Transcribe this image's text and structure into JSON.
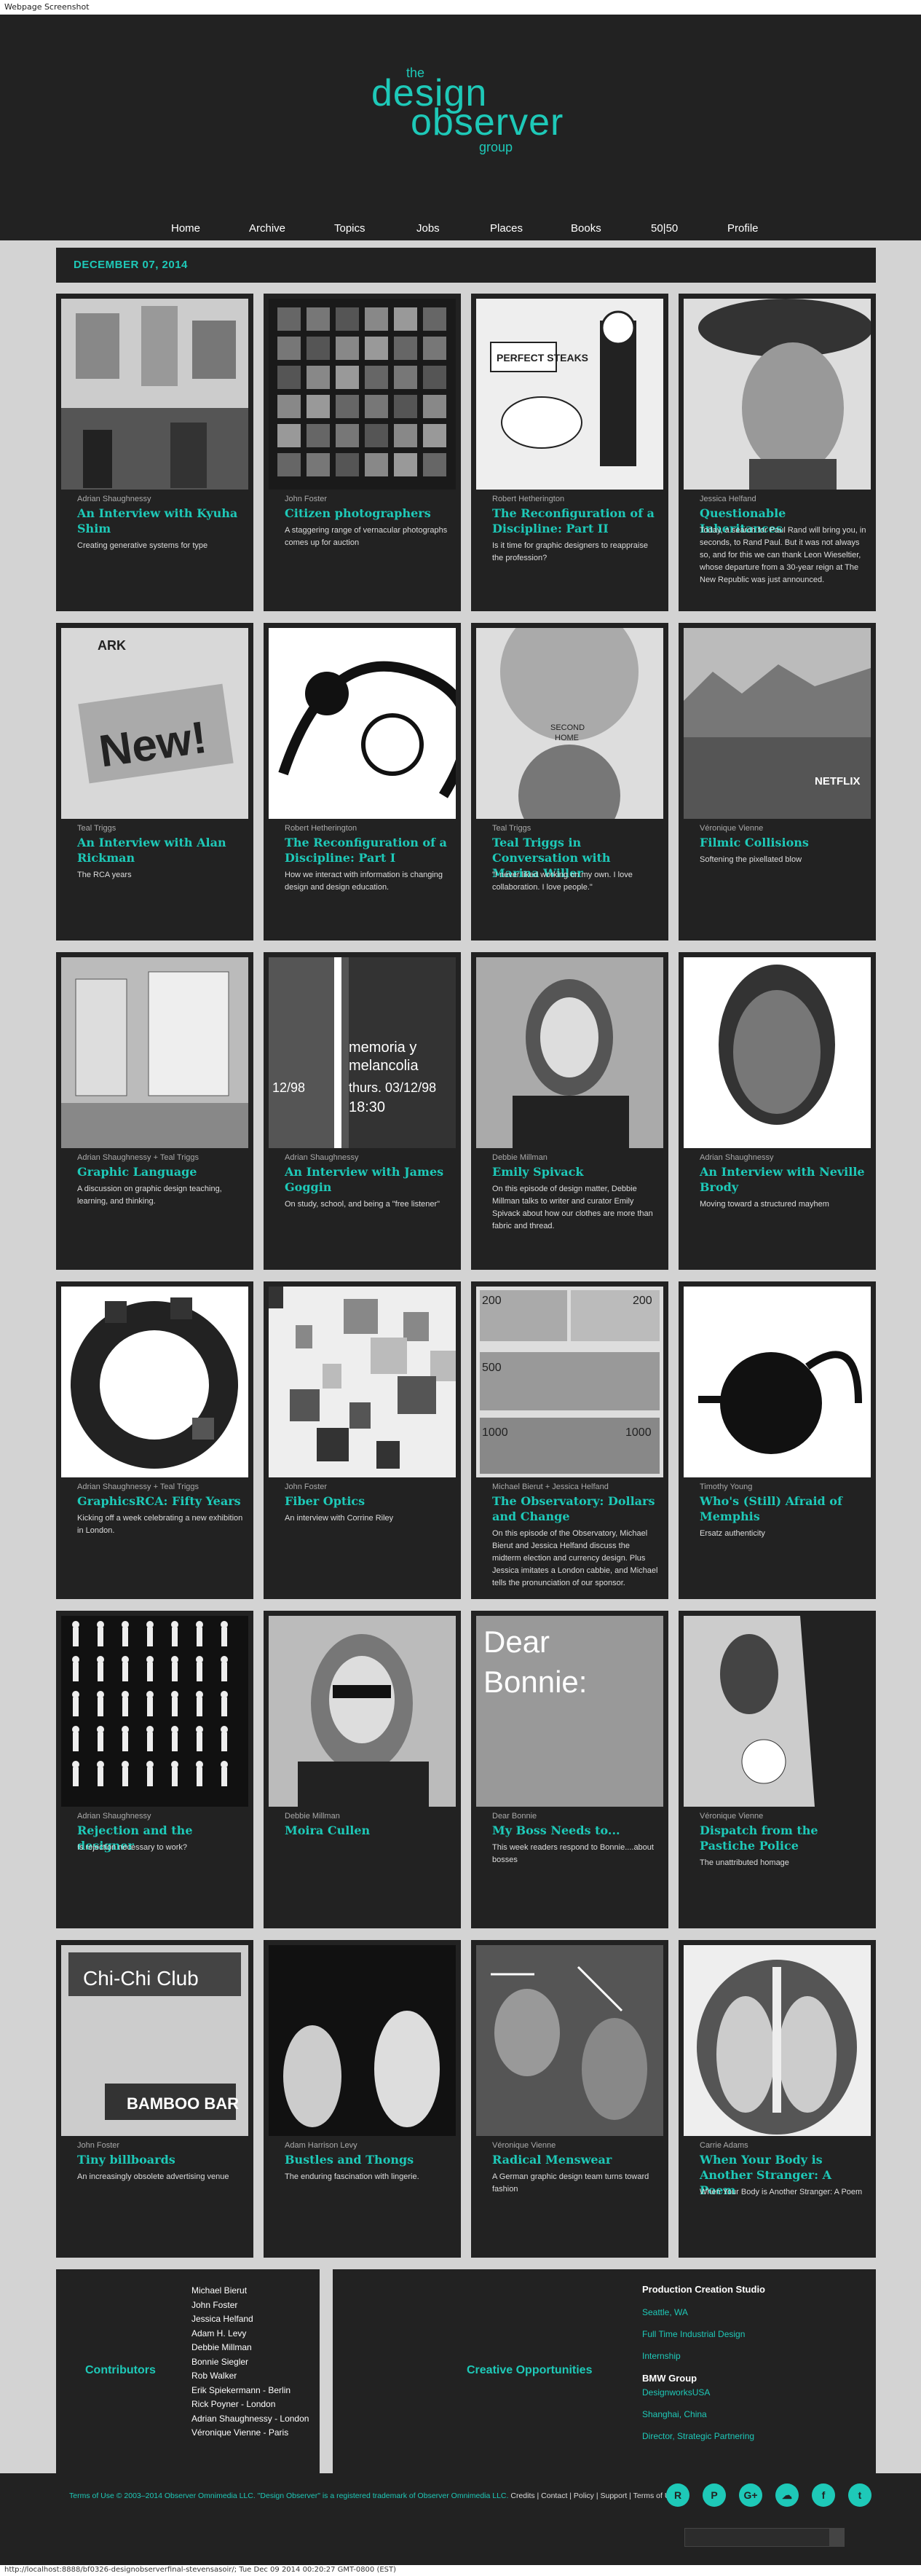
{
  "window": {
    "caption": "Webpage Screenshot",
    "url_status": "http://localhost:8888/bf0326-designobserverfinal-stevensasoir/; Tue Dec 09 2014 00:20:27 GMT-0800 (EST)"
  },
  "logo": {
    "the": "the",
    "design": "design",
    "observer": "observer",
    "group": "group"
  },
  "nav": [
    "Home",
    "Archive",
    "Topics",
    "Jobs",
    "Places",
    "Books",
    "50|50",
    "Profile"
  ],
  "date": "DECEMBER 07, 2014",
  "cards": [
    {
      "author": "Adrian Shaughnessy",
      "title": "An Interview with Kyuha Shim",
      "desc": "Creating generative systems for type"
    },
    {
      "author": "John Foster",
      "title": "Citizen photographers",
      "desc": "A staggering range of vernacular photographs comes up for auction"
    },
    {
      "author": "Robert Hetherington",
      "title": "The Reconfiguration of a Discipline: Part II",
      "desc": "Is it time for graphic designers to reappraise the profession?"
    },
    {
      "author": "Jessica Helfand",
      "title": "Questionable Inheritances",
      "desc": "Today, a search for Paul Rand will bring you, in seconds, to Rand Paul. But it was not always so, and for this we can thank Leon Wieseltier, whose departure from a 30-year reign at The New Republic was just announced."
    },
    {
      "author": "Teal Triggs",
      "title": "An Interview with Alan Rickman",
      "desc": "The RCA years"
    },
    {
      "author": "Robert Hetherington",
      "title": "The Reconfiguration of a Discipline: Part I",
      "desc": "How we interact with information is changing design and design education."
    },
    {
      "author": "Teal Triggs",
      "title": "Teal Triggs in Conversation with Marina Willer",
      "desc": "\"I never liked working on my own. I love collaboration. I love people.\""
    },
    {
      "author": "Véronique Vienne",
      "title": "Filmic Collisions",
      "desc": "Softening the pixellated blow"
    },
    {
      "author": "Adrian Shaughnessy + Teal Triggs",
      "title": "Graphic Language",
      "desc": "A discussion on graphic design teaching, learning, and thinking."
    },
    {
      "author": "Adrian Shaughnessy",
      "title": "An Interview with James Goggin",
      "desc": "On study, school, and being a \"free listener\""
    },
    {
      "author": "Debbie Millman",
      "title": "Emily Spivack",
      "desc": "On this episode of design matter, Debbie Millman talks to writer and curator Emily Spivack about how our clothes are more than fabric and thread."
    },
    {
      "author": "Adrian Shaughnessy",
      "title": "An Interview with Neville Brody",
      "desc": "Moving toward a structured mayhem"
    },
    {
      "author": "Adrian Shaughnessy + Teal Triggs",
      "title": "GraphicsRCA: Fifty Years",
      "desc": "Kicking off a week celebrating a new exhibition in London."
    },
    {
      "author": "John Foster",
      "title": "Fiber Optics",
      "desc": "An interview with Corrine Riley"
    },
    {
      "author": "Michael Bierut + Jessica Helfand",
      "title": "The Observatory: Dollars and Change",
      "desc": "On this episode of the Observatory, Michael Bierut and Jessica Helfand discuss the midterm election and currency design. Plus Jessica imitates a London cabbie, and Michael tells the pronunciation of our sponsor."
    },
    {
      "author": "Timothy Young",
      "title": "Who's (Still) Afraid of Memphis",
      "desc": "Ersatz authenticity"
    },
    {
      "author": "Adrian Shaughnessy",
      "title": "Rejection and the designer",
      "desc": "Is rejection necessary to work?"
    },
    {
      "author": "Debbie Millman",
      "title": "Moira Cullen",
      "desc": ""
    },
    {
      "author": "Dear Bonnie",
      "title": "My Boss Needs to...",
      "desc": "This week readers respond to Bonnie....about bosses"
    },
    {
      "author": "Véronique Vienne",
      "title": "Dispatch from the Pastiche Police",
      "desc": "The unattributed homage"
    },
    {
      "author": "John Foster",
      "title": "Tiny billboards",
      "desc": "An increasingly obsolete advertising venue"
    },
    {
      "author": "Adam Harrison Levy",
      "title": "Bustles and Thongs",
      "desc": "The enduring fascination with lingerie."
    },
    {
      "author": "Véronique Vienne",
      "title": "Radical Menswear",
      "desc": "A German graphic design team turns toward fashion"
    },
    {
      "author": "Carrie Adams",
      "title": "When Your Body is Another Stranger: A Poem",
      "desc": "When Your Body is Another Stranger: A Poem"
    }
  ],
  "image_text": {
    "ark": "ARK",
    "new": "New!",
    "second_home_1": "SECOND",
    "second_home_2": "HOME",
    "netflix": "NETFLIX",
    "memoria_1": "memoria y",
    "memoria_2": "melancolia",
    "memoria_3": "thurs. 03/12/98",
    "memoria_4": "18:30",
    "memoria_5": "12/98",
    "perfect_steaks": "PERFECT STEAKS",
    "dear_bonnie_1": "Dear",
    "dear_bonnie_2": "Bonnie:",
    "bamboo": "BAMBOO BAR",
    "chi_chi": "Chi-Chi Club",
    "bill_200": "200",
    "bill_500": "500",
    "bill_1000": "1000"
  },
  "contributors": {
    "heading": "Contributors",
    "names": [
      "Michael Bierut",
      "John Foster",
      "Jessica Helfand",
      "Adam H. Levy",
      "Debbie Millman",
      "Bonnie Siegler",
      "Rob Walker",
      "Erik Spiekermann - Berlin",
      "Rick Poyner - London",
      "Adrian Shaughnessy - London",
      "Véronique Vienne - Paris"
    ]
  },
  "creative": {
    "heading": "Creative Opportunities",
    "production_head": "Production Creation Studio",
    "production_links": [
      "Seattle, WA",
      "Full Time Industrial Design",
      "Internship"
    ],
    "bmw_head": "BMW Group",
    "bmw_links": [
      "DesignworksUSA",
      "Shanghai, China",
      "Director, Strategic Partnering"
    ]
  },
  "legal": {
    "teal_part": "Terms of Use © 2003–2014 Observer Omnimedia LLC. \"Design Observer\" is a registered trademark of Observer Omnimedia LLC.",
    "white_part": " Credits | Contact | Policy | Support | Terms of Use"
  },
  "social_icons": [
    "rss-icon",
    "pinterest-icon",
    "google-plus-icon",
    "soundcloud-icon",
    "facebook-icon",
    "twitter-icon"
  ],
  "social_glyphs": [
    "R",
    "P",
    "G+",
    "☁",
    "f",
    "t"
  ],
  "colors": {
    "accent": "#1ec9b8",
    "panel": "#222222",
    "page_bg": "#d3d3d3"
  }
}
